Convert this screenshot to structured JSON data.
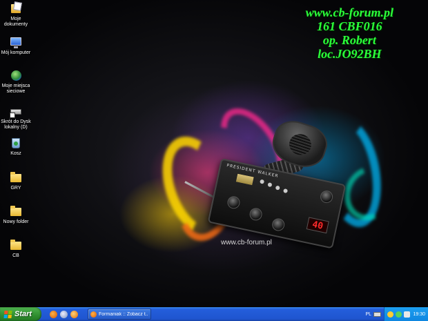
{
  "desktop": {
    "icons": [
      {
        "label": "Moje dokumenty",
        "icon": "my-documents-icon"
      },
      {
        "label": "Mój komputer",
        "icon": "my-computer-icon"
      },
      {
        "label": "Moje miejsca sieciowe",
        "icon": "network-places-icon"
      },
      {
        "label": "Skrót do Dysk lokalny (D)",
        "icon": "drive-shortcut-icon"
      },
      {
        "label": "Kosz",
        "icon": "recycle-bin-icon"
      },
      {
        "label": "GRY",
        "icon": "folder-icon"
      },
      {
        "label": "Nowy folder",
        "icon": "folder-icon"
      },
      {
        "label": "CB",
        "icon": "folder-icon"
      }
    ]
  },
  "wallpaper": {
    "lines": [
      "www.cb-forum.pl",
      "161 CBF016",
      "op. Robert",
      "loc.JO92BH"
    ],
    "url_caption": "www.cb-forum.pl",
    "radio_brand": "PRESIDENT WALKER",
    "radio_display": "40",
    "text_color": "#2bff3a"
  },
  "taskbar": {
    "start_label": "Start",
    "window_title": "Formaniak :: Zobacz t...",
    "language": "PL",
    "clock": "19:30"
  },
  "colors": {
    "taskbar_blue": "#245edb",
    "start_green": "#2f8e2f",
    "tray_blue": "#0f86e0"
  }
}
